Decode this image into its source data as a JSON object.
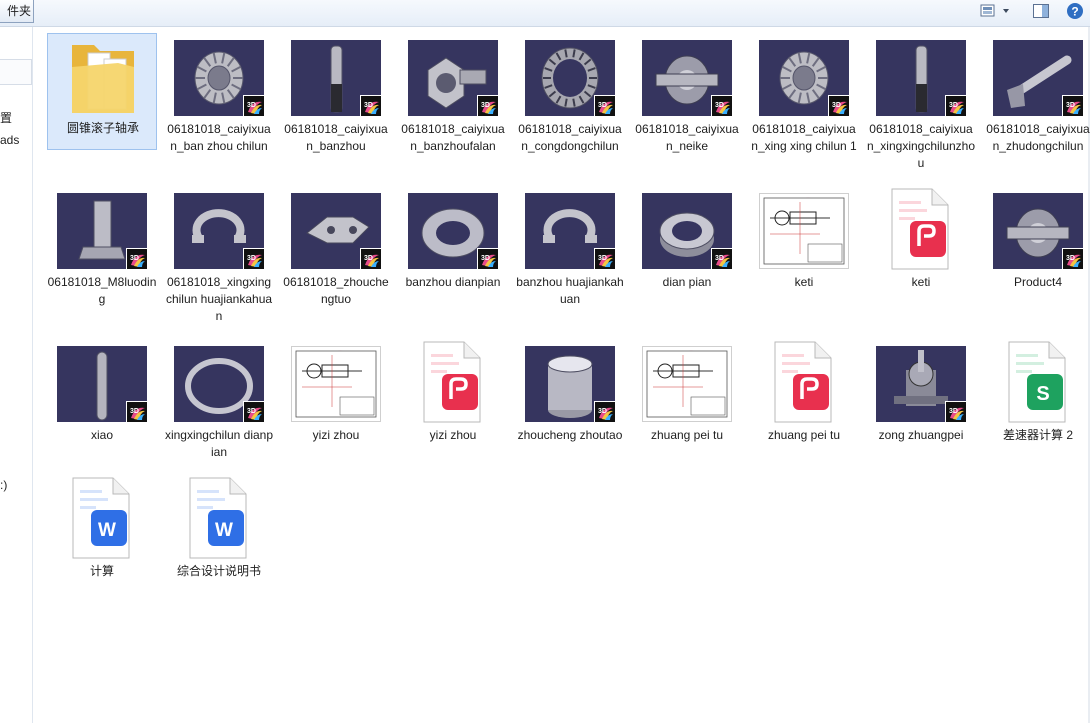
{
  "toolbar": {
    "new_folder_label": "件夹",
    "view_icon": "view-options-icon",
    "preview_icon": "preview-pane-icon",
    "help_icon": "help-icon"
  },
  "nav": {
    "items": [
      {
        "label": "置"
      },
      {
        "label": "ads"
      },
      {
        "label": ":)"
      }
    ]
  },
  "files": [
    {
      "name": "圆锥滚子轴承",
      "kind": "folder"
    },
    {
      "name": "06181018_caiyixuan_ban zhou chilun",
      "kind": "cad",
      "shape": "bevel-gear"
    },
    {
      "name": "06181018_caiyixuan_banzhou",
      "kind": "cad",
      "shape": "shaft"
    },
    {
      "name": "06181018_caiyixuan_banzhoufalan",
      "kind": "cad",
      "shape": "flange"
    },
    {
      "name": "06181018_caiyixuan_congdongchilun",
      "kind": "cad",
      "shape": "ring-gear"
    },
    {
      "name": "06181018_caiyixuan_neike",
      "kind": "cad",
      "shape": "housing"
    },
    {
      "name": "06181018_caiyixuan_xing xing chilun 1",
      "kind": "cad",
      "shape": "bevel-gear"
    },
    {
      "name": "06181018_caiyixuan_xingxingchilunzhou",
      "kind": "cad",
      "shape": "shaft"
    },
    {
      "name": "06181018_caiyixuan_zhudongchilun",
      "kind": "cad",
      "shape": "pinion"
    },
    {
      "name": "06181018_M8luoding",
      "kind": "cad",
      "shape": "bolt"
    },
    {
      "name": "06181018_xingxingchilun huajiankahuan",
      "kind": "cad",
      "shape": "clip"
    },
    {
      "name": "06181018_zhouchengtuo",
      "kind": "cad",
      "shape": "bracket"
    },
    {
      "name": "banzhou dianpian",
      "kind": "cad",
      "shape": "washer"
    },
    {
      "name": "banzhou huajiankahuan",
      "kind": "cad",
      "shape": "clip"
    },
    {
      "name": "dian pian",
      "kind": "cad",
      "shape": "thick-washer"
    },
    {
      "name": "keti",
      "kind": "drawing"
    },
    {
      "name": "keti",
      "kind": "pdf"
    },
    {
      "name": "Product4",
      "kind": "cad",
      "shape": "housing"
    },
    {
      "name": "xiao",
      "kind": "cad",
      "shape": "pin"
    },
    {
      "name": "xingxingchilun dianpian",
      "kind": "cad",
      "shape": "thin-ring"
    },
    {
      "name": "yizi zhou",
      "kind": "drawing"
    },
    {
      "name": "yizi zhou",
      "kind": "pdf"
    },
    {
      "name": "zhoucheng zhoutao",
      "kind": "cad",
      "shape": "sleeve"
    },
    {
      "name": "zhuang pei tu",
      "kind": "drawing"
    },
    {
      "name": "zhuang pei tu",
      "kind": "pdf"
    },
    {
      "name": "zong zhuangpei",
      "kind": "cad",
      "shape": "assembly"
    },
    {
      "name": "差速器计算 2",
      "kind": "sheet"
    },
    {
      "name": "计算",
      "kind": "word"
    },
    {
      "name": "综合设计说明书",
      "kind": "word"
    }
  ],
  "colors": {
    "cad_bg": "#36355f",
    "pdf_red": "#e8304e",
    "word_blue": "#2f6fe6",
    "sheet_green": "#1ea25f",
    "folder_yellow": "#f2c94c",
    "selection": "#dbe9fb"
  }
}
